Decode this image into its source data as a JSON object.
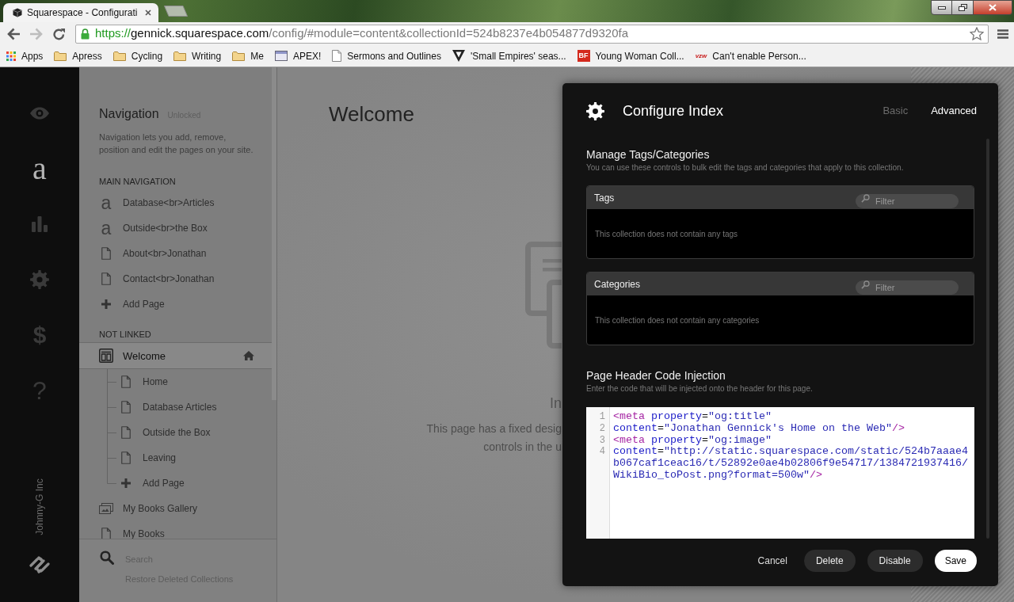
{
  "browser": {
    "tab": {
      "title": "Squarespace - Configurati"
    },
    "nav_buttons": [
      {
        "kind": "back",
        "disabled": false
      },
      {
        "kind": "forward",
        "disabled": true
      },
      {
        "kind": "reload",
        "disabled": false
      }
    ],
    "address": {
      "scheme": "https://",
      "host": "gennick.squarespace.com",
      "path": "/config/#module=content&collectionId=524b8237e4b054877d9320fa"
    },
    "bookmarks": [
      {
        "kind": "apps",
        "label": "Apps"
      },
      {
        "kind": "folder",
        "label": "Apress"
      },
      {
        "kind": "folder",
        "label": "Cycling"
      },
      {
        "kind": "folder",
        "label": "Writing"
      },
      {
        "kind": "folder",
        "label": "Me"
      },
      {
        "kind": "window",
        "label": "APEX!"
      },
      {
        "kind": "page",
        "label": "Sermons and Outlines"
      },
      {
        "kind": "shield",
        "label": "'Small Empires' seas..."
      },
      {
        "kind": "badge",
        "badge": "BF",
        "label": "Young Woman Coll..."
      },
      {
        "kind": "logo_text",
        "badge": "vzw",
        "label": "Can't enable Person..."
      }
    ]
  },
  "rail": {
    "items": [
      {
        "kind": "eye",
        "selected": false
      },
      {
        "kind": "letter",
        "glyph": "a",
        "selected": true
      },
      {
        "kind": "chart",
        "selected": false
      },
      {
        "kind": "gear",
        "selected": false
      },
      {
        "kind": "dollar",
        "glyph": "$",
        "selected": false
      },
      {
        "kind": "help",
        "glyph": "?",
        "selected": false
      }
    ],
    "account": "Johnny-G Inc"
  },
  "navigation": {
    "title": "Navigation",
    "lock_status": "Unlocked",
    "description": "Navigation lets you add, remove, position and edit the pages on your site.",
    "sections": [
      {
        "heading": "MAIN NAVIGATION",
        "items": [
          {
            "kind": "collection",
            "glyph": "a",
            "label": "Database<br>Articles",
            "selected": false,
            "home": false
          },
          {
            "kind": "collection",
            "glyph": "a",
            "label": "Outside<br>the Box",
            "selected": false,
            "home": false
          },
          {
            "kind": "page",
            "label": "About<br>Jonathan",
            "selected": false,
            "home": false
          },
          {
            "kind": "page",
            "label": "Contact<br>Jonathan",
            "selected": false,
            "home": false
          },
          {
            "kind": "add",
            "label": "Add Page",
            "selected": false,
            "home": false
          }
        ]
      },
      {
        "heading": "NOT LINKED",
        "items": [
          {
            "kind": "index",
            "label": "Welcome",
            "selected": true,
            "home": true,
            "children": [
              {
                "kind": "page",
                "label": "Home",
                "selected": false,
                "home": false
              },
              {
                "kind": "page",
                "label": "Database Articles",
                "selected": false,
                "home": false
              },
              {
                "kind": "page",
                "label": "Outside the Box",
                "selected": false,
                "home": false
              },
              {
                "kind": "page",
                "label": "Leaving",
                "selected": false,
                "home": false
              },
              {
                "kind": "add",
                "label": "Add Page",
                "selected": false,
                "home": false
              }
            ]
          },
          {
            "kind": "gallery",
            "label": "My Books Gallery",
            "selected": false,
            "home": false
          },
          {
            "kind": "page",
            "label": "My Books",
            "selected": false,
            "home": false
          }
        ]
      }
    ],
    "search": {
      "placeholder": "Search"
    },
    "restore_link": "Restore Deleted Collections"
  },
  "page": {
    "title": "Welcome",
    "notice_title": "In",
    "notice_lines": [
      "This page has a fixed desig",
      "controls in the u"
    ]
  },
  "dialog": {
    "title": "Configure Index",
    "tabs": [
      {
        "label": "Basic",
        "selected": false
      },
      {
        "label": "Advanced",
        "selected": true
      }
    ],
    "sections": [
      {
        "kind": "tag_manager",
        "title": "Manage Tags/Categories",
        "subtitle": "You can use these controls to bulk edit the tags and categories that apply to this collection.",
        "lists": [
          {
            "title": "Tags",
            "filter_placeholder": "Filter",
            "empty_text": "This collection does not contain any tags"
          },
          {
            "title": "Categories",
            "filter_placeholder": "Filter",
            "empty_text": "This collection does not contain any categories"
          }
        ]
      },
      {
        "kind": "code",
        "title": "Page Header Code Injection",
        "subtitle": "Enter the code that will be injected onto the header for this page.",
        "lines": [
          {
            "number": "1",
            "tokens": [
              {
                "kind": "tag",
                "text": "<meta"
              },
              {
                "kind": "attribute",
                "text": " property"
              },
              {
                "kind": "operator",
                "text": "="
              },
              {
                "kind": "string",
                "text": "\"og:title\""
              }
            ]
          },
          {
            "number": "2",
            "tokens": [
              {
                "kind": "attribute",
                "text": "content"
              },
              {
                "kind": "operator",
                "text": "="
              },
              {
                "kind": "string",
                "text": "\"Jonathan Gennick's Home on the Web\""
              },
              {
                "kind": "tag",
                "text": "/>"
              }
            ]
          },
          {
            "number": "3",
            "tokens": [
              {
                "kind": "tag",
                "text": "<meta"
              },
              {
                "kind": "attribute",
                "text": " property"
              },
              {
                "kind": "operator",
                "text": "="
              },
              {
                "kind": "string",
                "text": "\"og:image\""
              }
            ]
          },
          {
            "number": "4",
            "tokens": [
              {
                "kind": "attribute",
                "text": "content"
              },
              {
                "kind": "operator",
                "text": "="
              },
              {
                "kind": "string",
                "text": "\"http://static.squarespace.com/static/524b7aaae4b067caf1ceac16/t/52892e0ae4b02806f9e54717/1384721937416/WikiBio_toPost.png?format=500w\""
              },
              {
                "kind": "tag",
                "text": "/>"
              }
            ]
          }
        ]
      }
    ],
    "buttons": [
      {
        "kind": "text",
        "label": "Cancel"
      },
      {
        "kind": "secondary",
        "label": "Delete"
      },
      {
        "kind": "secondary",
        "label": "Disable"
      },
      {
        "kind": "primary",
        "label": "Save"
      }
    ]
  }
}
